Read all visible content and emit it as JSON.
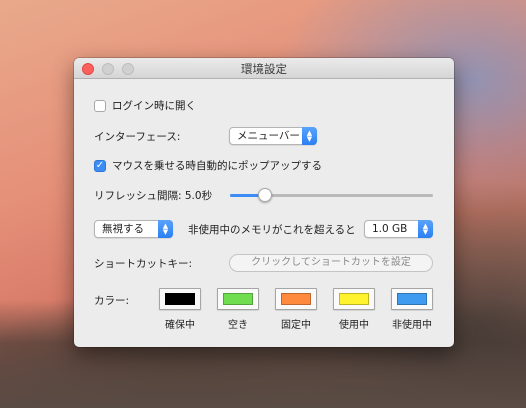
{
  "window": {
    "title": "環境設定"
  },
  "login": {
    "label": "ログイン時に開く",
    "checked": false
  },
  "interface": {
    "label": "インターフェース:",
    "value": "メニューバー"
  },
  "hover": {
    "label": "マウスを乗せる時自動的にポップアップする",
    "checked": true
  },
  "refresh": {
    "label": "リフレッシュ間隔: 5.0秒",
    "level_fraction": 0.15
  },
  "memory": {
    "action_value": "無視する",
    "condition_label": "非使用中のメモリがこれを超えると",
    "threshold_value": "1.0 GB"
  },
  "shortcut": {
    "label": "ショートカットキー:",
    "placeholder": "クリックしてショートカットを設定"
  },
  "colors": {
    "label": "カラー:",
    "swatches": [
      {
        "label": "確保中",
        "color": "#000000"
      },
      {
        "label": "空き",
        "color": "#6fdd4f"
      },
      {
        "label": "固定中",
        "color": "#ff8a3d"
      },
      {
        "label": "使用中",
        "color": "#fff22e"
      },
      {
        "label": "非使用中",
        "color": "#3f9bef"
      }
    ]
  }
}
